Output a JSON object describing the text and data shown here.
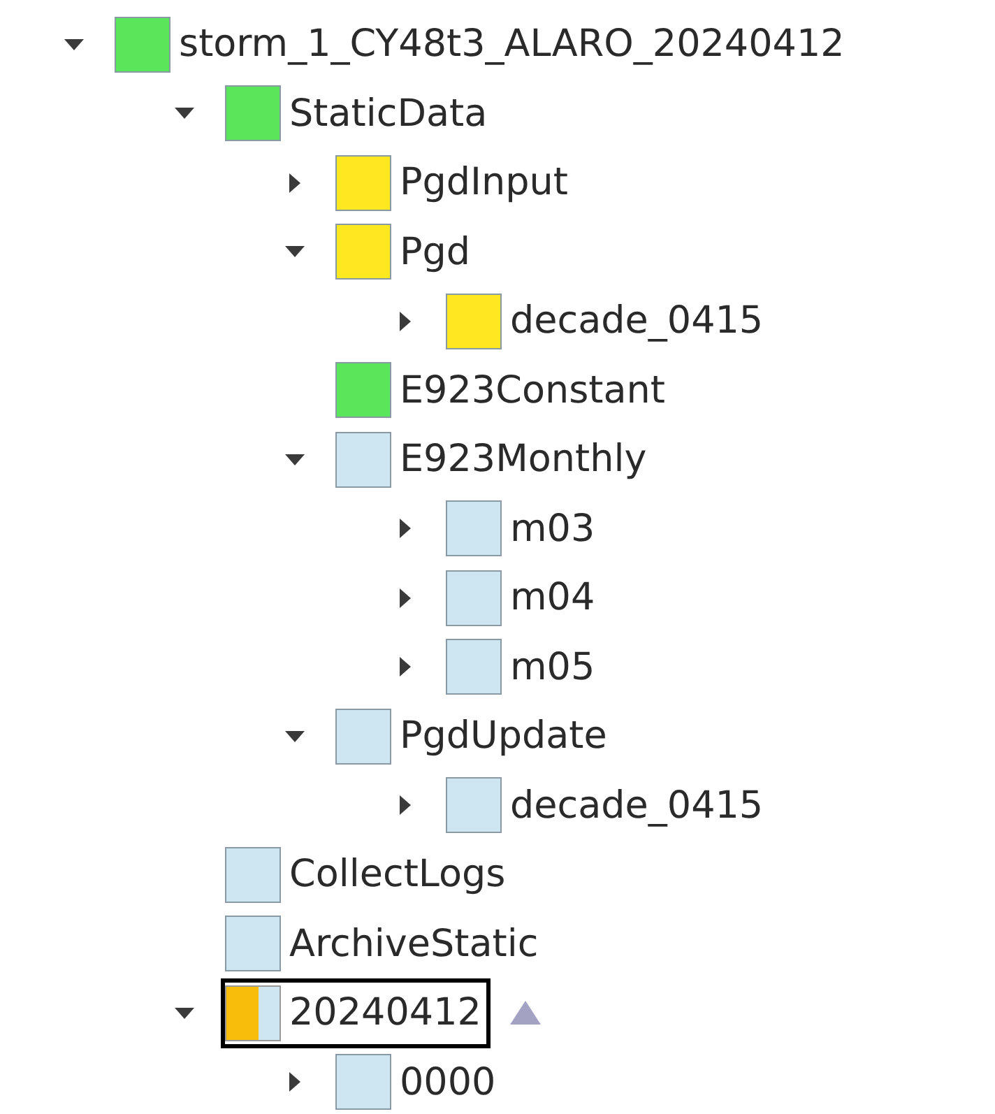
{
  "tree": [
    {
      "name": "storm_1_CY48t3_ALARO_20240412",
      "color": "#5ae65a",
      "expanded": true,
      "selected": false,
      "children": [
        {
          "name": "StaticData",
          "color": "#5ae65a",
          "expanded": true,
          "selected": false,
          "children": [
            {
              "name": "PgdInput",
              "color": "#ffe81f",
              "expanded": false,
              "selected": false
            },
            {
              "name": "Pgd",
              "color": "#ffe81f",
              "expanded": true,
              "selected": false,
              "children": [
                {
                  "name": "decade_0415",
                  "color": "#ffe81f",
                  "expanded": false,
                  "selected": false
                }
              ]
            },
            {
              "name": "E923Constant",
              "color": "#5ae65a",
              "selected": false
            },
            {
              "name": "E923Monthly",
              "color": "#cde6f2",
              "expanded": true,
              "selected": false,
              "children": [
                {
                  "name": "m03",
                  "color": "#cde6f2",
                  "expanded": false,
                  "selected": false
                },
                {
                  "name": "m04",
                  "color": "#cde6f2",
                  "expanded": false,
                  "selected": false
                },
                {
                  "name": "m05",
                  "color": "#cde6f2",
                  "expanded": false,
                  "selected": false
                }
              ]
            },
            {
              "name": "PgdUpdate",
              "color": "#cde6f2",
              "expanded": true,
              "selected": false,
              "children": [
                {
                  "name": "decade_0415",
                  "color": "#cde6f2",
                  "expanded": false,
                  "selected": false
                }
              ]
            }
          ]
        },
        {
          "name": "CollectLogs",
          "color": "#cde6f2",
          "selected": false
        },
        {
          "name": "ArchiveStatic",
          "color": "#cde6f2",
          "selected": false
        },
        {
          "name": "20240412",
          "segments": [
            {
              "color": "#f7bd0a"
            },
            {
              "color": "#cde6f2"
            }
          ],
          "expanded": true,
          "selected": true,
          "late": true,
          "children": [
            {
              "name": "0000",
              "color": "#cde6f2",
              "expanded": false,
              "selected": false
            }
          ]
        }
      ]
    }
  ]
}
